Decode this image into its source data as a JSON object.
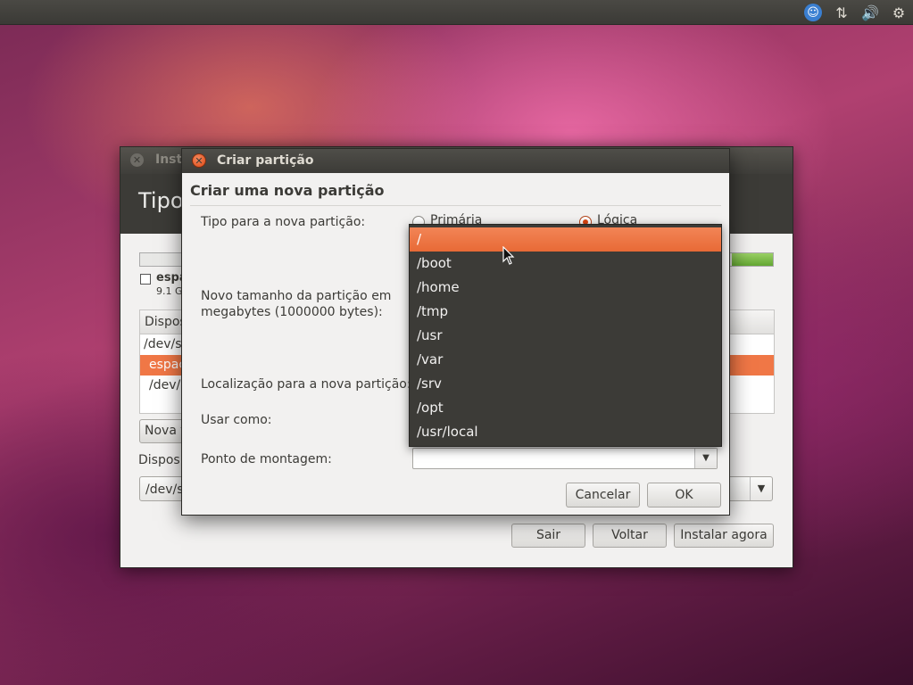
{
  "background_window": {
    "title": "Inst",
    "header_title": "Tipo",
    "legend_label": "espa",
    "legend_size": "9.1 G",
    "table_header": "Dispos",
    "rows": [
      "/dev/s",
      "espaç",
      "/dev/"
    ],
    "new_table_button": "Nova t",
    "device_label": "Disposi",
    "device_value": "/dev/s",
    "buttons": {
      "quit": "Sair",
      "back": "Voltar",
      "install": "Instalar agora"
    }
  },
  "dialog": {
    "title": "Criar partição",
    "heading": "Criar uma nova partição",
    "type_label": "Tipo para a nova partição:",
    "type_options": {
      "primary": "Primária",
      "logical": "Lógica"
    },
    "size_label": "Novo tamanho da partição em megabytes (1000000 bytes):",
    "location_label": "Localização para a nova partição:",
    "use_as_label": "Usar como:",
    "mount_point_label": "Ponto de montagem:",
    "mount_point_value": "",
    "cancel_button": "Cancelar",
    "ok_button": "OK"
  },
  "mount_point_dropdown": {
    "selected": "/",
    "options": [
      "/",
      "/boot",
      "/home",
      "/tmp",
      "/usr",
      "/var",
      "/srv",
      "/opt",
      "/usr/local"
    ]
  },
  "tray": {
    "icons": [
      "accessibility-icon",
      "network-icon",
      "volume-icon",
      "power-icon"
    ]
  },
  "colors": {
    "accent": "#dd4814",
    "selection": "#f07746",
    "panel": "#3c3b37"
  }
}
